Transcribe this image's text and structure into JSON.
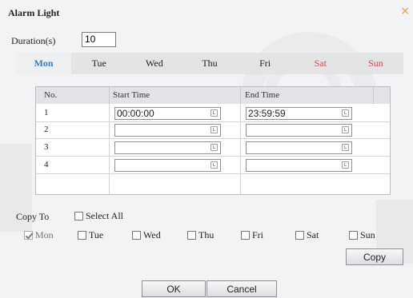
{
  "dialog": {
    "title": "Alarm Light",
    "close_icon": "×"
  },
  "duration": {
    "label": "Duration(s)",
    "value": "10"
  },
  "tabs": [
    {
      "label": "Mon",
      "state": "active"
    },
    {
      "label": "Tue"
    },
    {
      "label": "Wed"
    },
    {
      "label": "Thu"
    },
    {
      "label": "Fri"
    },
    {
      "label": "Sat",
      "weekend": true
    },
    {
      "label": "Sun",
      "weekend": true
    }
  ],
  "schedule_table": {
    "headers": {
      "no": "No.",
      "start": "Start Time",
      "end": "End Time"
    },
    "rows": [
      {
        "no": "1",
        "start": "00:00:00",
        "end": "23:59:59"
      },
      {
        "no": "2",
        "start": "",
        "end": ""
      },
      {
        "no": "3",
        "start": "",
        "end": ""
      },
      {
        "no": "4",
        "start": "",
        "end": ""
      }
    ]
  },
  "copy": {
    "copy_to_label": "Copy To",
    "select_all_label": "Select All",
    "select_all_checked": false,
    "days": [
      {
        "label": "Mon",
        "checked": true,
        "disabled": true
      },
      {
        "label": "Tue",
        "checked": false
      },
      {
        "label": "Wed",
        "checked": false
      },
      {
        "label": "Thu",
        "checked": false
      },
      {
        "label": "Fri",
        "checked": false
      },
      {
        "label": "Sat",
        "checked": false
      },
      {
        "label": "Sun",
        "checked": false
      }
    ],
    "copy_button": "Copy"
  },
  "footer": {
    "ok_button": "OK",
    "cancel_button": "Cancel"
  },
  "colors": {
    "active_tab": "#3a7dbf",
    "weekend_tab": "#e0413d",
    "close_icon": "#f09a3a"
  }
}
